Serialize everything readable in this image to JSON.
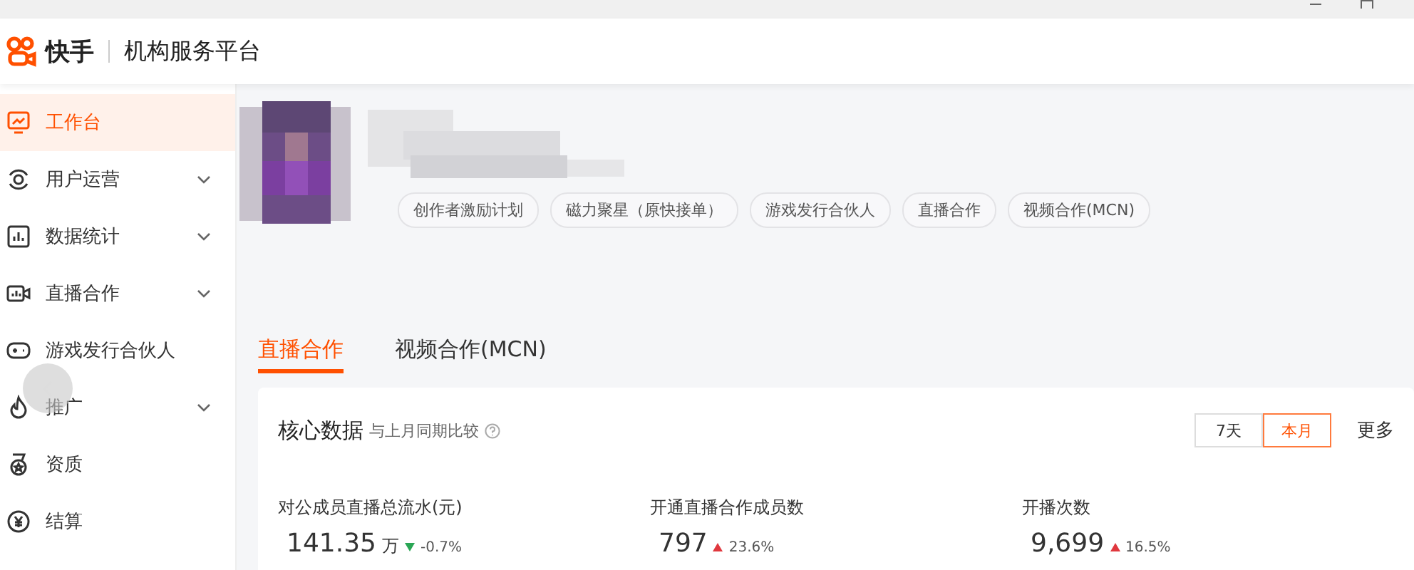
{
  "header": {
    "brand": "快手",
    "platform": "机构服务平台"
  },
  "sidebar": {
    "items": [
      {
        "label": "工作台",
        "selected": true,
        "expandable": false
      },
      {
        "label": "用户运营",
        "selected": false,
        "expandable": true
      },
      {
        "label": "数据统计",
        "selected": false,
        "expandable": true
      },
      {
        "label": "直播合作",
        "selected": false,
        "expandable": true
      },
      {
        "label": "游戏发行合伙人",
        "selected": false,
        "expandable": false
      },
      {
        "label": "推广",
        "selected": false,
        "expandable": true
      },
      {
        "label": "资质",
        "selected": false,
        "expandable": false
      },
      {
        "label": "结算",
        "selected": false,
        "expandable": false
      }
    ]
  },
  "profile": {
    "tags": [
      "创作者激励计划",
      "磁力聚星（原快接单）",
      "游戏发行合伙人",
      "直播合作",
      "视频合作(MCN)"
    ]
  },
  "tabs": [
    {
      "label": "直播合作",
      "selected": true
    },
    {
      "label": "视频合作(MCN)",
      "selected": false
    }
  ],
  "card": {
    "title": "核心数据",
    "subtitle": "与上月同期比较",
    "ranges": [
      {
        "label": "7天",
        "selected": false
      },
      {
        "label": "本月",
        "selected": true
      }
    ],
    "more": "更多",
    "metrics": [
      {
        "label": "对公成员直播总流水(元)",
        "value": "141.35",
        "unit": "万",
        "kind": "down",
        "change": "-0.7%"
      },
      {
        "label": "开通直播合作成员数",
        "value": "797",
        "kind": "up",
        "change": "23.6%"
      },
      {
        "label": "开播次数",
        "value": "9,699",
        "kind": "up",
        "change": "16.5%"
      }
    ]
  }
}
